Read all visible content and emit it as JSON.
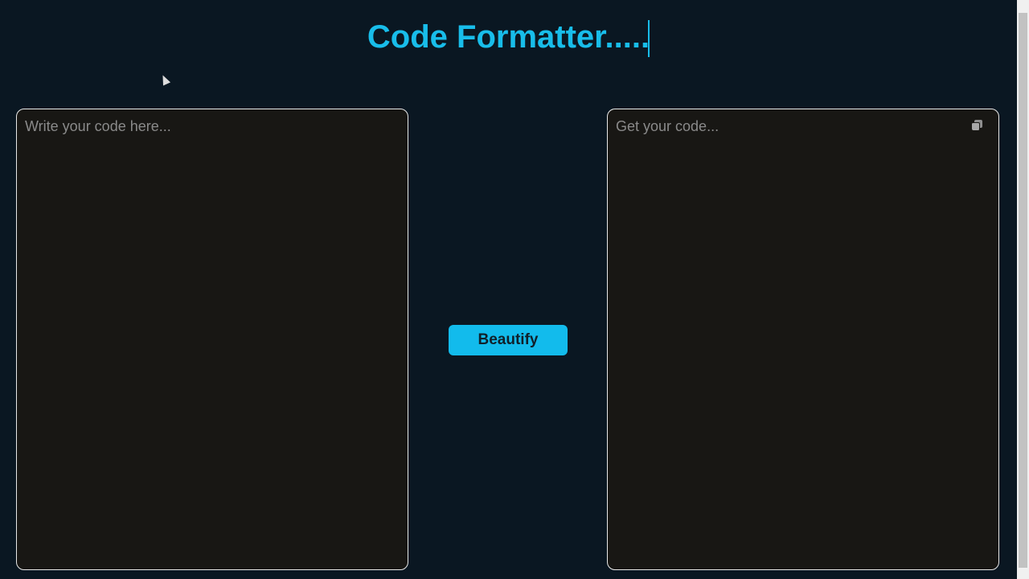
{
  "header": {
    "title": "Code Formatter....."
  },
  "input": {
    "placeholder": "Write your code here...",
    "value": ""
  },
  "output": {
    "placeholder": "Get your code...",
    "value": ""
  },
  "actions": {
    "beautify_label": "Beautify"
  },
  "colors": {
    "accent": "#18bdea",
    "background": "#0a1722",
    "panel": "#181714"
  }
}
